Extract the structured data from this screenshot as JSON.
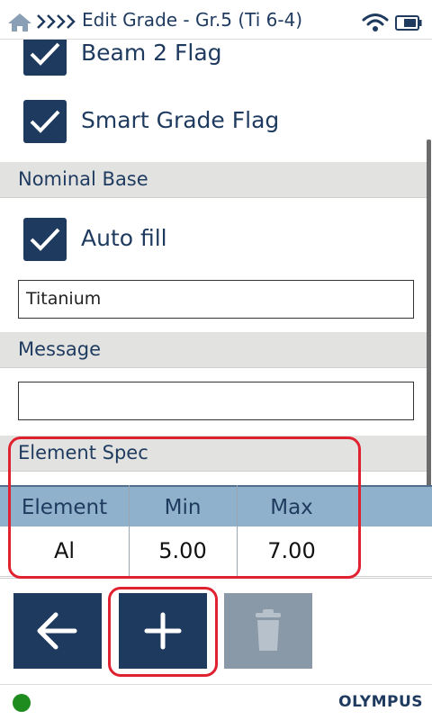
{
  "header": {
    "title": "Edit Grade - Gr.5 (Ti 6-4)",
    "home_icon": "home-icon",
    "breadcrumb_icon": "chevrons-icon",
    "wifi_icon": "wifi-icon",
    "battery_icon": "battery-icon"
  },
  "flags": [
    {
      "label": "Beam 2 Flag",
      "checked": true
    },
    {
      "label": "Smart Grade Flag",
      "checked": true
    }
  ],
  "nominal_base": {
    "section_title": "Nominal Base",
    "autofill_label": "Auto fill",
    "autofill_checked": true,
    "base_value": "Titanium"
  },
  "message": {
    "section_title": "Message",
    "value": ""
  },
  "element_spec": {
    "section_title": "Element Spec",
    "columns": [
      "Element",
      "Min",
      "Max"
    ],
    "rows": [
      [
        "Al",
        "5.00",
        "7.00"
      ]
    ]
  },
  "toolbar": {
    "back_icon": "arrow-left-icon",
    "add_icon": "plus-icon",
    "delete_icon": "trash-icon",
    "delete_enabled": false
  },
  "footer": {
    "status": "connected",
    "status_color": "#1f8c1f",
    "brand": "OLYMPUS"
  },
  "colors": {
    "primary": "#1f3a5f",
    "table_header": "#8fb1cb",
    "section_bg": "#e2e3e1",
    "highlight": "#e0212f",
    "disabled": "#8a99a8"
  }
}
